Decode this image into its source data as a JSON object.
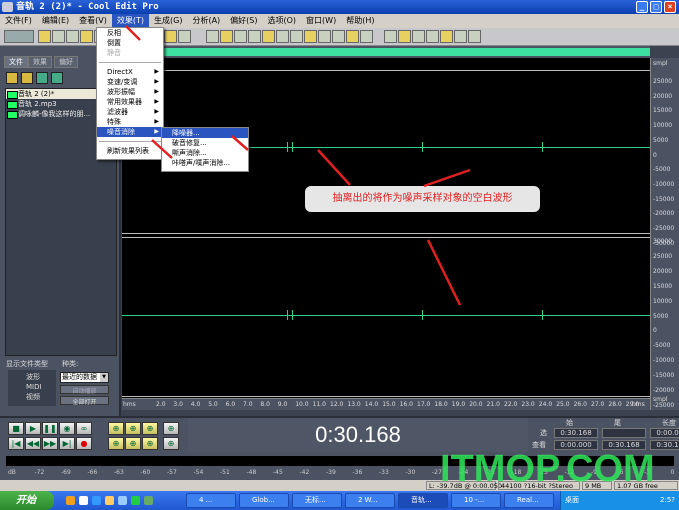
{
  "title": "音轨 2 (2)* - Cool Edit Pro",
  "menubar": [
    "文件(F)",
    "编辑(E)",
    "查看(V)",
    "效果(T)",
    "生成(G)",
    "分析(A)",
    "偏好(S)",
    "选项(O)",
    "窗口(W)",
    "帮助(H)"
  ],
  "effects_menu": {
    "items": [
      {
        "label": "反相"
      },
      {
        "label": "倒置"
      },
      {
        "label": "静音",
        "disabled": true
      },
      {
        "label": "DirectX",
        "sub": true
      },
      {
        "label": "变速/变调",
        "sub": true
      },
      {
        "label": "波形振幅",
        "sub": true
      },
      {
        "label": "常用效果器",
        "sub": true
      },
      {
        "label": "滤波器",
        "sub": true
      },
      {
        "label": "特殊",
        "sub": true
      },
      {
        "label": "噪音消除",
        "sub": true,
        "highlighted": true
      },
      {
        "label": "刷新效果列表"
      }
    ]
  },
  "noise_submenu": [
    "降噪器...",
    "破音修复...",
    "嘶声消除...",
    "咔嗒声/噗声消除..."
  ],
  "left_panel": {
    "tabs": [
      "文件",
      "效果",
      "偏好"
    ],
    "files": [
      "音轨 2 (2)*",
      "音轨 2.mp3",
      "调咏麟-像我这样的朋..."
    ],
    "show_types_label": "显示文件类型",
    "types": [
      "波形",
      "MIDI",
      "视频"
    ],
    "sort_label": "种类:",
    "sort_value": "最近的数据",
    "buttons": [
      "自动播放",
      "全部打开"
    ]
  },
  "waveform": {
    "y_unit": "smpl",
    "top_axis": [
      "25000",
      "20000",
      "15000",
      "10000",
      "5000",
      "0",
      "-5000",
      "-10000",
      "-15000",
      "-20000",
      "-25000",
      "-30000"
    ],
    "bottom_axis": [
      "30000",
      "25000",
      "20000",
      "15000",
      "10000",
      "5000",
      "0",
      "-5000",
      "-10000",
      "-15000",
      "-20000",
      "-25000"
    ],
    "x_unit": "hms",
    "x_ticks": [
      "2.0",
      "3.0",
      "4.0",
      "5.0",
      "6.0",
      "7.0",
      "8.0",
      "9.0",
      "10.0",
      "11.0",
      "12.0",
      "13.0",
      "14.0",
      "15.0",
      "16.0",
      "17.0",
      "18.0",
      "19.0",
      "20.0",
      "21.0",
      "22.0",
      "23.0",
      "24.0",
      "25.0",
      "26.0",
      "27.0",
      "28.0",
      "29.0"
    ]
  },
  "annotation": "抽离出的将作为噪声采样对象的空白波形",
  "time_display": "0:30.168",
  "selection": {
    "headers": [
      "始",
      "尾",
      "长度"
    ],
    "rows": [
      {
        "label": "选",
        "values": [
          "0:30.168",
          "",
          "0:00.000"
        ]
      },
      {
        "label": "查看",
        "values": [
          "0:00.000",
          "0:30.168",
          "0:30.168"
        ]
      }
    ]
  },
  "meter_ticks": [
    "dB",
    "-72",
    "-69",
    "-66",
    "-63",
    "-60",
    "-57",
    "-54",
    "-51",
    "-48",
    "-45",
    "-42",
    "-39",
    "-36",
    "-33",
    "-30",
    "-27",
    "-24",
    "-21",
    "-18",
    "-15",
    "-12",
    "-9",
    "-6",
    "-3",
    "0"
  ],
  "status": {
    "level": "L: -39.7dB @ 0:00.050",
    "format": "44100 ?16-bit ?Stereo",
    "size": "9 MB",
    "free": "1.07 GB free"
  },
  "watermark": "ITMOP.COM",
  "taskbar": {
    "start": "开始",
    "tasks": [
      "4 ...",
      "Glob...",
      "无标...",
      "2 W...",
      "音轨...",
      "10 -...",
      "Real..."
    ],
    "tray": "桌面",
    "clock": "2:5?"
  },
  "colors": {
    "waveform": "#2ed08c",
    "background": "#000000",
    "panel": "#4b5262",
    "annotation": "#e02020"
  }
}
